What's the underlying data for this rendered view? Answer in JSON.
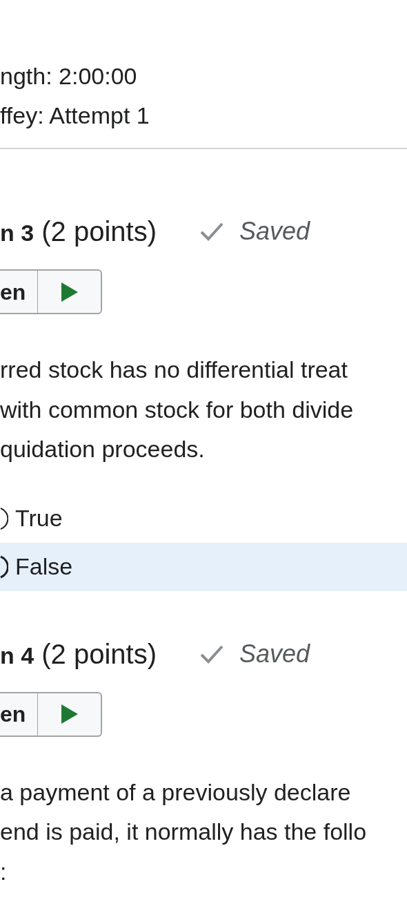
{
  "header": {
    "lines": [
      "ngth: 2:00:00",
      "ffey: Attempt 1"
    ]
  },
  "questions": [
    {
      "title_bold": "n 3",
      "title_rest": "(2 points)",
      "status": "Saved",
      "listen": "en",
      "text_lines": [
        "rred stock has no differential treat",
        "with common stock for both divide",
        "quidation proceeds."
      ],
      "options": [
        {
          "label": "True",
          "selected": false
        },
        {
          "label": "False",
          "selected": true
        }
      ]
    },
    {
      "title_bold": "n 4",
      "title_rest": "(2 points)",
      "status": "Saved",
      "listen": "en",
      "text_lines": [
        "a payment of a previously declare",
        "end is paid, it normally has the follo",
        ":"
      ]
    }
  ]
}
